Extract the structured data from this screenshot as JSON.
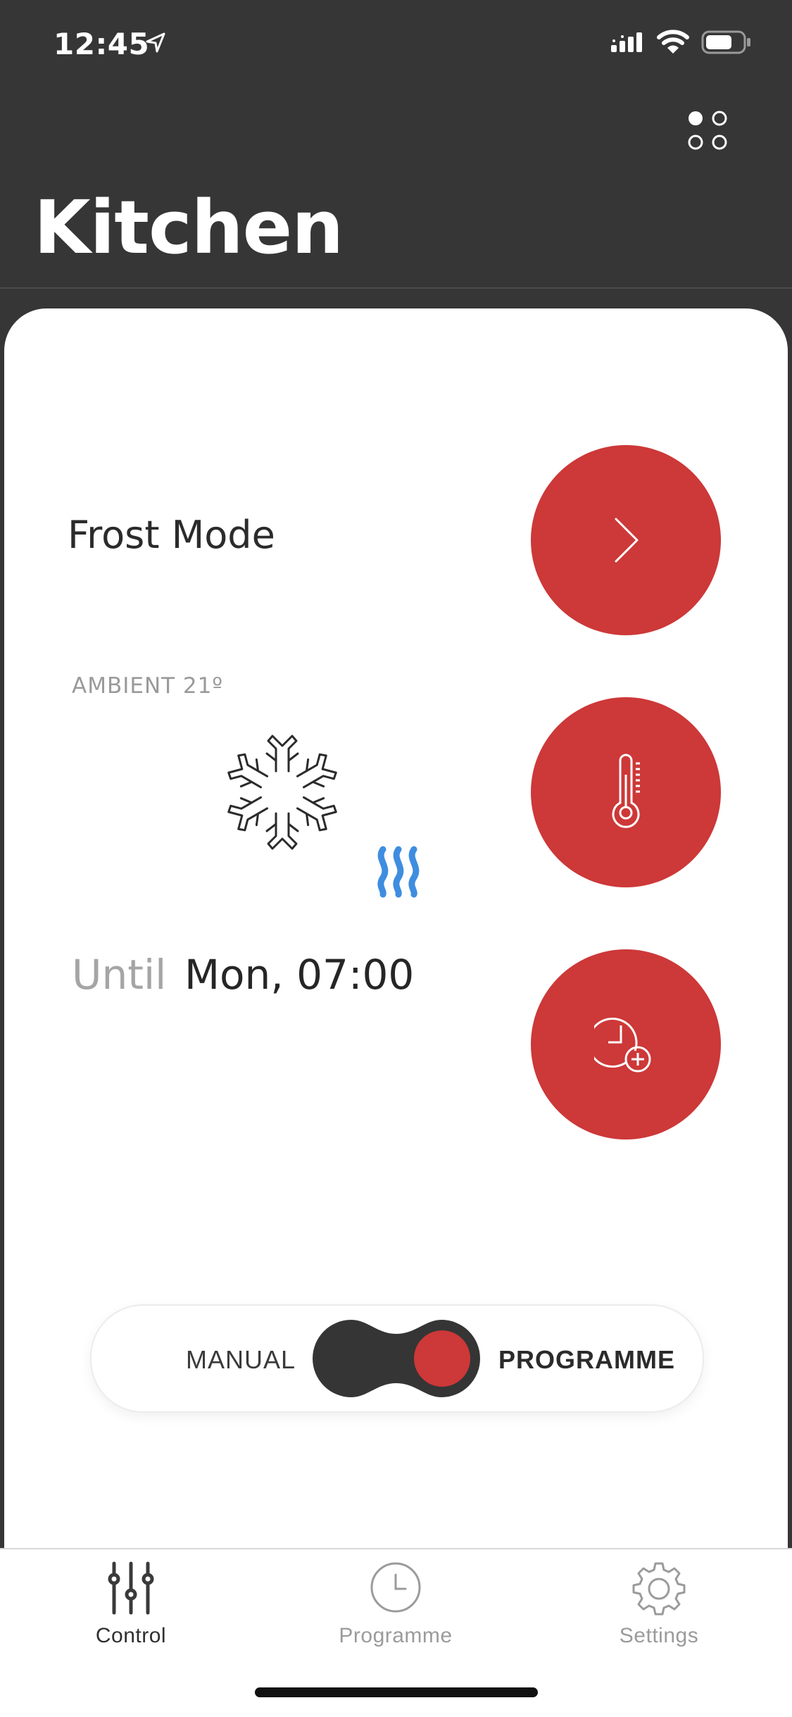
{
  "status_bar": {
    "time": "12:45",
    "icons": [
      "location-arrow-icon",
      "cellular-signal-icon",
      "wifi-icon",
      "battery-icon"
    ]
  },
  "header": {
    "title": "Kitchen",
    "rooms_icon": "grid-dots-icon"
  },
  "main": {
    "mode": "Frost Mode",
    "ambient": "AMBIENT 21º",
    "until_label": "Until",
    "until_value": "Mon, 07:00",
    "buttons": {
      "next_icon": "chevron-right-icon",
      "temperature_icon": "thermometer-icon",
      "boost_icon": "clock-plus-icon"
    }
  },
  "mode_switch": {
    "manual_label": "MANUAL",
    "programme_label": "PROGRAMME",
    "selected": "PROGRAMME"
  },
  "tabbar": {
    "tabs": [
      {
        "label": "Control",
        "icon": "sliders-icon",
        "active": true
      },
      {
        "label": "Programme",
        "icon": "clock-icon",
        "active": false
      },
      {
        "label": "Settings",
        "icon": "gear-icon",
        "active": false
      }
    ]
  },
  "colors": {
    "header_bg": "#363636",
    "accent_red": "#cd3838",
    "heat_blue": "#3f8de0",
    "card_bg": "#ffffff"
  }
}
